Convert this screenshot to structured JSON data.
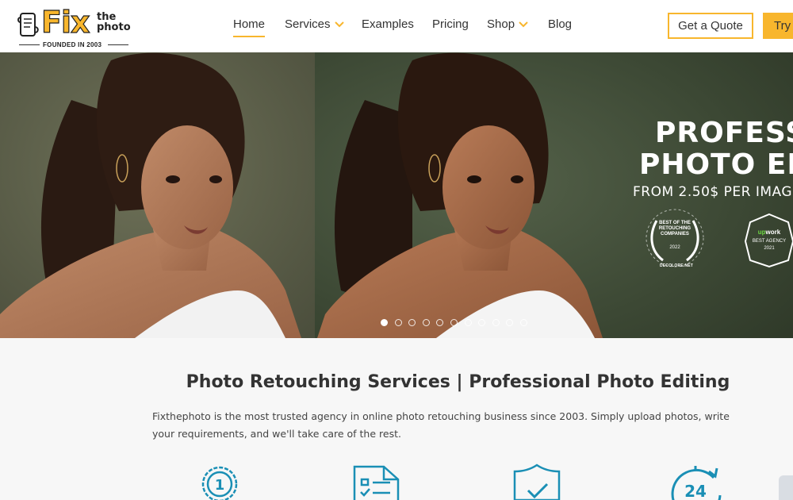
{
  "logo": {
    "brand": "Fix",
    "brand_sub_1": "the",
    "brand_sub_2": "photo",
    "founded": "FOUNDED IN 2003"
  },
  "nav": {
    "items": [
      {
        "label": "Home",
        "active": true,
        "has_dropdown": false
      },
      {
        "label": "Services",
        "active": false,
        "has_dropdown": true
      },
      {
        "label": "Examples",
        "active": false,
        "has_dropdown": false
      },
      {
        "label": "Pricing",
        "active": false,
        "has_dropdown": false
      },
      {
        "label": "Shop",
        "active": false,
        "has_dropdown": true
      },
      {
        "label": "Blog",
        "active": false,
        "has_dropdown": false
      }
    ],
    "quote_button": "Get a Quote",
    "try_button": "Try"
  },
  "hero": {
    "title_line1": "PROFESSI",
    "title_line2": "PHOTO ED",
    "subtitle": "FROM 2.50$ PER IMAG",
    "badge_best": {
      "text": "BEST OF THE RETOUCHING COMPANIES",
      "year": "2022",
      "source": "DECOLORE.NET"
    },
    "badge_upwork": {
      "logo_up": "up",
      "logo_work": "work",
      "text": "BEST AGENCY",
      "year": "2021"
    },
    "slides_count": 11,
    "active_slide": 1
  },
  "content": {
    "title": "Photo Retouching Services | Professional Photo Editing",
    "description": "Fixthephoto is the most trusted agency in online photo retouching business since 2003. Simply upload photos, write your requirements, and we'll take care of the rest.",
    "features": [
      {
        "icon": "number-one-medal-icon",
        "label": "1"
      },
      {
        "icon": "checklist-document-icon",
        "label": ""
      },
      {
        "icon": "shield-check-icon",
        "label": ""
      },
      {
        "icon": "clock-24-icon",
        "label": "24"
      }
    ]
  },
  "colors": {
    "accent": "#f8b62d",
    "icon_teal": "#1a8fb5",
    "content_bg": "#f7f7f7"
  }
}
